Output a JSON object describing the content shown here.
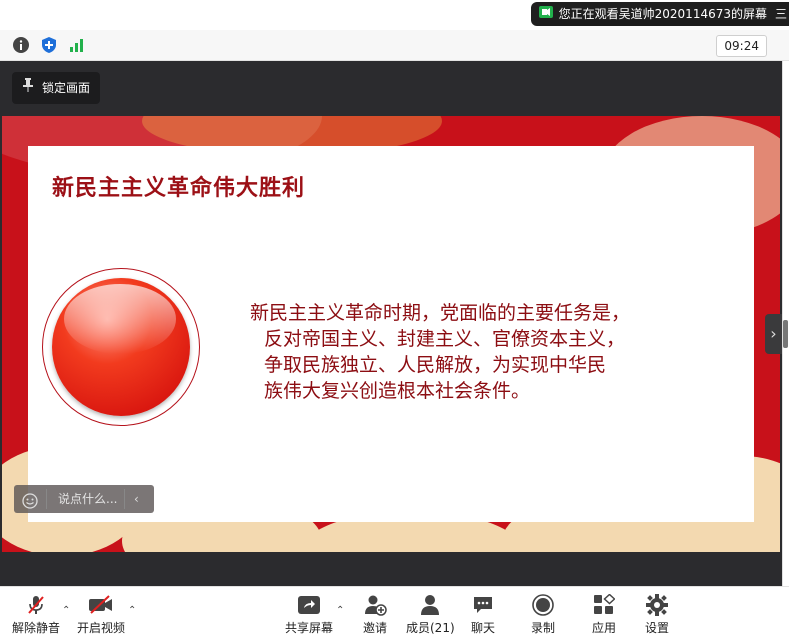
{
  "banner": {
    "text": "您正在观看吴道帅2020114673的屏幕",
    "more": "三"
  },
  "status": {
    "clock": "09:24"
  },
  "share": {
    "lock_label": "锁定画面",
    "slide": {
      "title": "新民主主义革命伟大胜利",
      "lines": [
        "新民主主义革命时期，党面临的主要任务是，",
        "反对帝国主义、封建主义、官僚资本主义，",
        "争取民族独立、人民解放，为实现中华民",
        "族伟大复兴创造根本社会条件。"
      ]
    },
    "chat_placeholder": "说点什么..."
  },
  "toolbar": {
    "unmute": "解除静音",
    "start_video": "开启视频",
    "share_screen": "共享屏幕",
    "invite": "邀请",
    "members": "成员(21)",
    "chat": "聊天",
    "record": "录制",
    "apps": "应用",
    "settings": "设置"
  },
  "colors": {
    "accent_green": "#22b14c",
    "slide_red": "#9c1016",
    "shield_blue": "#1e6fd9"
  }
}
